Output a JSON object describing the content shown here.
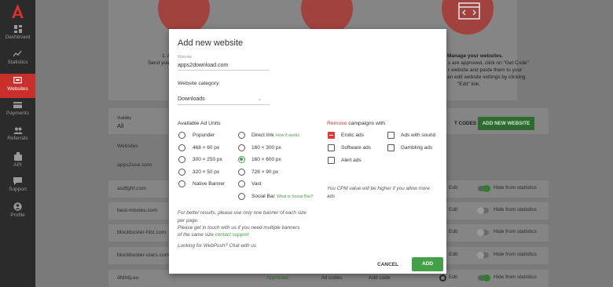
{
  "sidebar": {
    "items": [
      {
        "label": "Dashboard",
        "icon": "dashboard-icon"
      },
      {
        "label": "Statistics",
        "icon": "statistics-icon"
      },
      {
        "label": "Websites",
        "icon": "websites-icon"
      },
      {
        "label": "Payments",
        "icon": "payments-icon"
      },
      {
        "label": "Referrals",
        "icon": "referrals-icon"
      },
      {
        "label": "API",
        "icon": "api-icon"
      },
      {
        "label": "Support",
        "icon": "support-icon"
      },
      {
        "label": "Profile",
        "icon": "profile-icon"
      }
    ],
    "active": "Websites",
    "accent": "#c9302c"
  },
  "background": {
    "step1_title": "1. A",
    "step1_text": "Send you",
    "step3_title": "Manage your websites.",
    "step3_lines": [
      "s are approved, click on \"Get Code\"",
      "r website and paste them to your",
      "an edit website settings by clicking",
      "\"Edit\" link."
    ],
    "visibility_label": "Visibility",
    "visibility_value": "All",
    "websites_header": "Websites",
    "codes_label": "T CODES",
    "add_website_button": "ADD NEW WEBSITE",
    "rows": [
      {
        "site": "apps2use.com"
      },
      {
        "site": "asdfghf.com",
        "edit": "Edit",
        "hide": "Hide from statistics",
        "toggle": true
      },
      {
        "site": "best-movies.com",
        "edit": "Edit",
        "hide": "Hide from statistics",
        "toggle": false
      },
      {
        "site": "blockbuster-hitz.com",
        "edit": "Edit",
        "hide": "Hide from statistics",
        "toggle": false
      },
      {
        "site": "blockbuster-stars.com",
        "edit": "Edit",
        "hide": "Hide from statistics",
        "toggle": false
      },
      {
        "site": "dfdhtij.eu",
        "status": "Approved",
        "all_codes": "All codes",
        "add_code": "Add code",
        "edit": "Edit",
        "hide": "Hide from statistics",
        "toggle": true
      }
    ]
  },
  "modal": {
    "title": "Add new website",
    "website_label": "Website",
    "website_value": "apps2download.com",
    "category_label": "Website category:",
    "category_value": "Downloads",
    "ad_units_label": "Available Ad Units",
    "ad_units_left": [
      "Popunder",
      "468 × 60 px",
      "300 × 250 px",
      "320 × 50 px",
      "Native Banner"
    ],
    "ad_units_right": [
      "Direct link",
      "160 × 300 px",
      "160 × 600 px",
      "728 × 90 px",
      "Vast",
      "Social Bar"
    ],
    "selected_ad_unit": "160 × 600 px",
    "direct_link_help": "How it works",
    "social_bar_help": "What is Social Bar?",
    "remove_word": "Remove",
    "remove_rest": " campaigns with",
    "campaigns": [
      {
        "label": "Erotic ads",
        "checked": true
      },
      {
        "label": "Ads with sound",
        "checked": false
      },
      {
        "label": "Software ads",
        "checked": false
      },
      {
        "label": "Gambling ads",
        "checked": false
      },
      {
        "label": "Alert ads",
        "checked": false
      }
    ],
    "cpm_note_1": "You CPM value will be higher if you allow more",
    "cpm_note_2": "ads",
    "tip_line_1": "For better results, please use only one banner of each size",
    "tip_line_2": "per page.",
    "tip_line_3": "Please get in touch with us if you need multiple banners",
    "tip_line_4a": "of the same size ",
    "tip_line_4b": "contact support",
    "webpush_link": "Looking for WebPush? Chat with us",
    "cancel_label": "CANCEL",
    "add_label": "ADD"
  },
  "colors": {
    "green": "#43a047",
    "red": "#e53935"
  }
}
